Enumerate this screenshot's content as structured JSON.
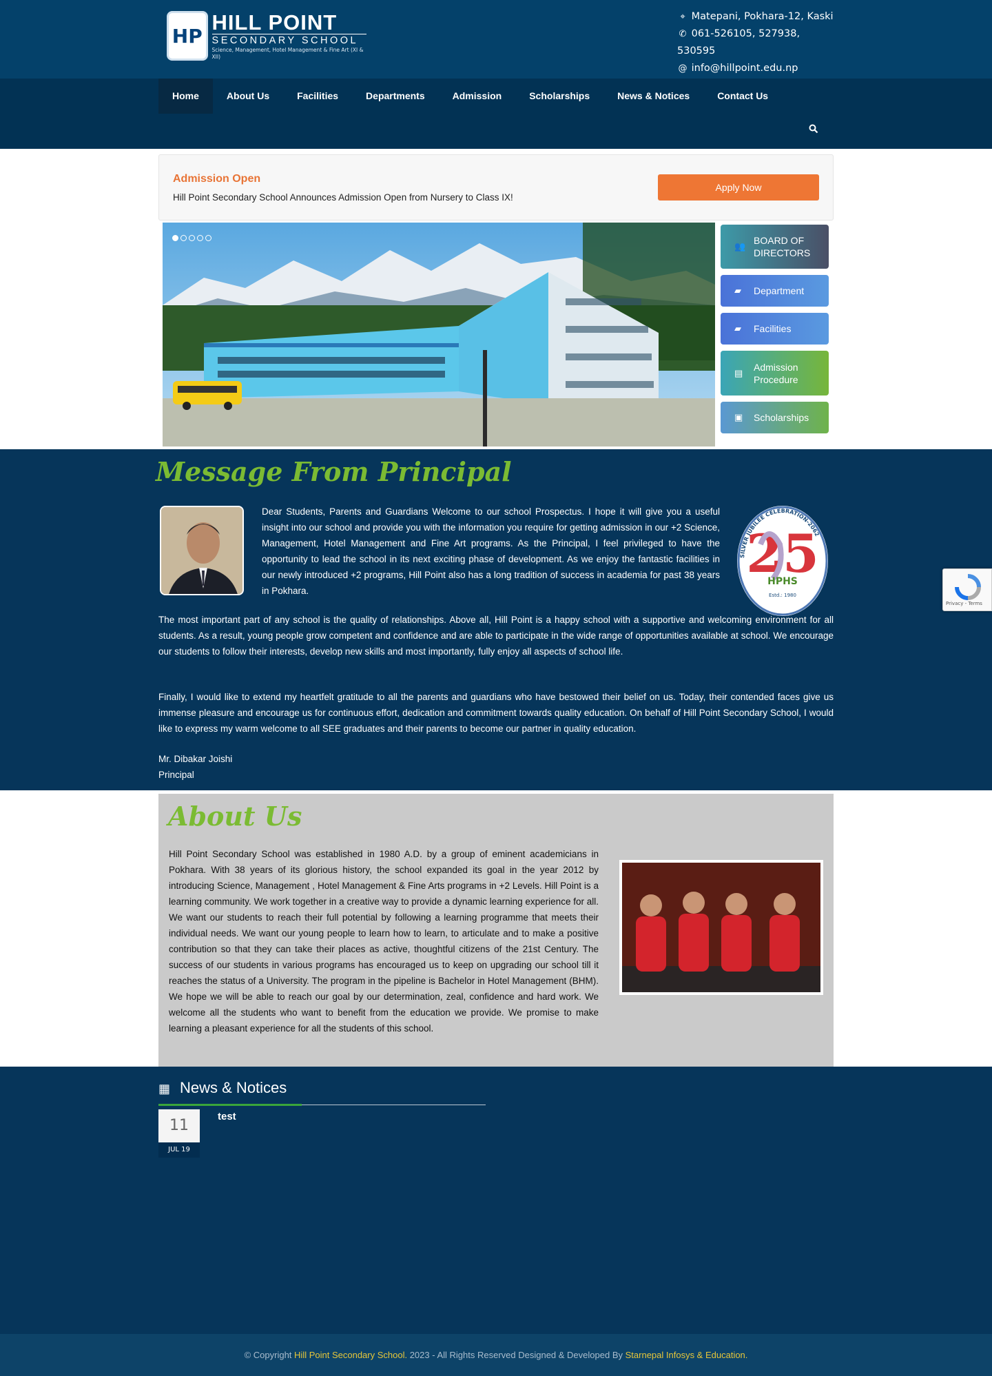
{
  "header": {
    "logo_badge": "HP",
    "logo_name": "HILL POINT",
    "logo_sub": "SECONDARY SCHOOL",
    "logo_tag": "Science, Management, Hotel Management & Fine Art (XI & XII)",
    "address": "Matepani, Pokhara-12, Kaski",
    "phone": "061-526105, 527938, 530595",
    "email": "info@hillpoint.edu.np"
  },
  "nav": {
    "items": [
      "Home",
      "About Us",
      "Facilities",
      "Departments",
      "Admission",
      "Scholarships",
      "News & Notices",
      "Contact Us"
    ],
    "active": "Home"
  },
  "admission": {
    "title": "Admission Open",
    "text": "Hill Point Secondary School Announces Admission Open from Nursery to Class IX!",
    "button": "Apply Now"
  },
  "sidebar": {
    "items": [
      {
        "label": "BOARD OF DIRECTORS",
        "icon": "users-icon"
      },
      {
        "label": "Department",
        "icon": "folder-icon"
      },
      {
        "label": "Facilities",
        "icon": "folder-icon"
      },
      {
        "label": "Admission Procedure",
        "icon": "book-icon"
      },
      {
        "label": "Scholarships",
        "icon": "money-icon"
      }
    ]
  },
  "principal": {
    "title": "Message From Principal",
    "intro": "Dear Students, Parents and Guardians Welcome to our school Prospectus. I hope it will give you a useful insight into our school and provide you with the information you require for getting admission in our +2 Science, Management, Hotel Management and Fine Art programs. As the Principal, I feel privileged to have the opportunity to lead the school in its next exciting phase of development. As we enjoy the fantastic facilities in our newly introduced +2 programs, Hill Point also has a long tradition of success in academia for past 38 years in Pokhara.",
    "para2": "The most important part of any school is the quality of relationships. Above all, Hill Point is a happy school with a supportive and welcoming environment for all students. As a result, young people grow competent and confidence and are able to participate in the wide range of opportunities available at school. We encourage our students to follow their interests, develop new skills and most importantly, fully enjoy all aspects of school life.",
    "para3": "Finally, I would like to extend my heartfelt gratitude to all the parents and guardians who have bestowed their belief on us. Today, their contended faces give us immense pleasure and encourage us for continuous effort, dedication and commitment towards quality education. On behalf of Hill Point Secondary School, I would like to express my warm welcome to all SEE graduates and their parents to become our partner in quality education.",
    "name": "Mr. Dibakar Joishi",
    "role": "Principal",
    "jubilee_arc": "SILVER JUBILEE CELEBRATION-2062",
    "jubilee_hphs": "HPHS",
    "jubilee_est": "Estd.: 1980"
  },
  "about": {
    "title": "About Us",
    "text": "Hill Point Secondary School was established in 1980 A.D. by a group of eminent academicians in Pokhara. With 38 years of its glorious history, the school expanded its goal in the year 2012 by introducing Science, Management , Hotel Management & Fine Arts programs in +2 Levels. Hill Point is a learning community. We work together in a creative way to provide a dynamic learning experience for all. We want our students to reach their full potential by following a learning programme that meets their individual needs. We want our young people to learn how to learn, to articulate and to make a positive contribution so that they can take their places as active, thoughtful citizens of the 21st Century. The success of our students in various programs has encouraged us to keep on upgrading our school till it reaches the status of a University. The program in the pipeline is Bachelor in Hotel Management (BHM). We hope we will be able to reach our goal by our determination, zeal, confidence and hard work. We welcome all the students who want to benefit from the education we provide. We promise to make learning a pleasant experience for all the students of this school."
  },
  "news": {
    "title": "News & Notices",
    "items": [
      {
        "day": "11",
        "month": "JUL 19",
        "title": "test"
      }
    ]
  },
  "footer": {
    "prefix": "© Copyright",
    "school": "Hill Point Secondary School.",
    "middle": "2023 - All Rights Reserved Designed & Developed By",
    "developer": "Starnepal Infosys & Education."
  },
  "recaptcha": {
    "text": "Privacy - Terms"
  },
  "colors": {
    "brand": "#04416a",
    "accent": "#ee7634",
    "green": "#7bbb33"
  }
}
